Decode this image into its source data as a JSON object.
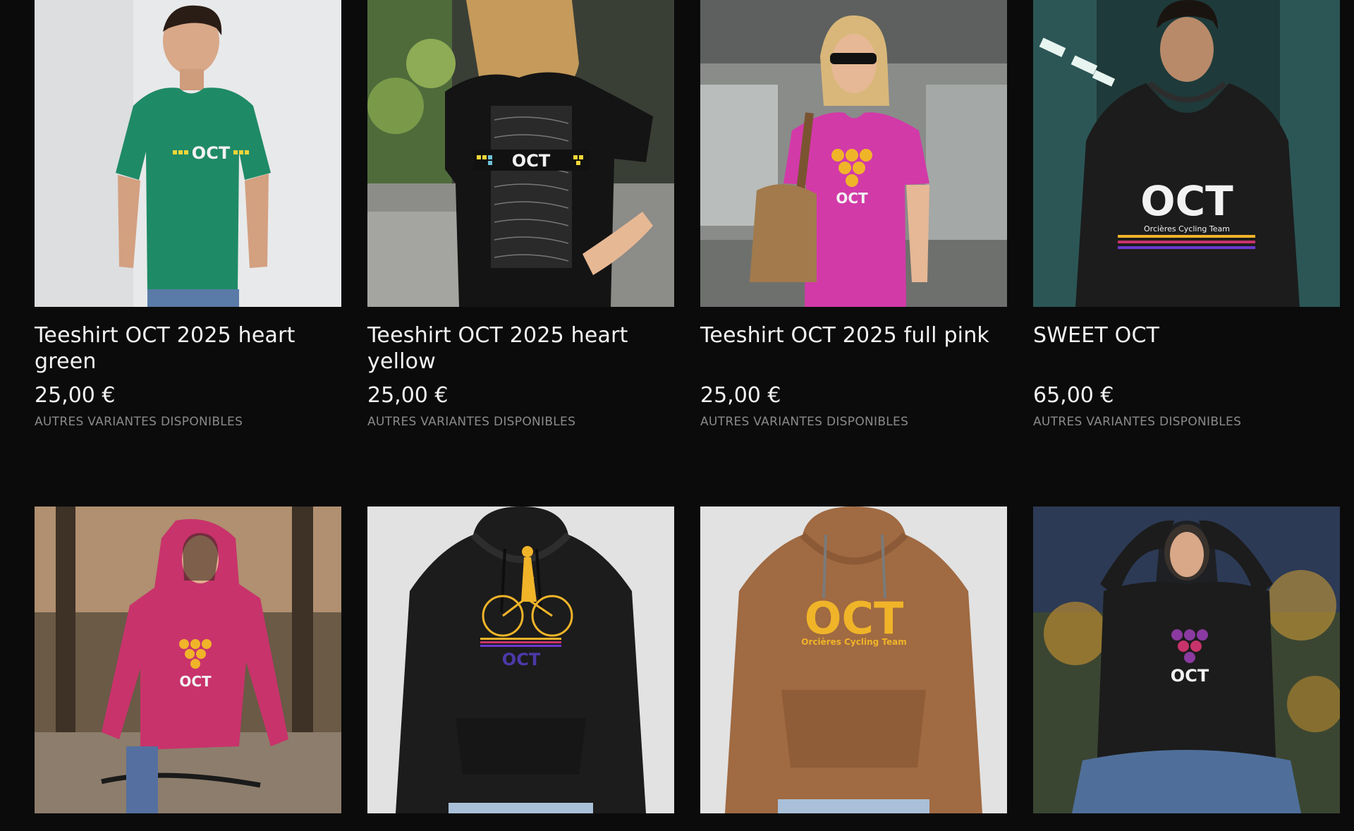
{
  "products": [
    {
      "title": "Teeshirt OCT 2025 heart green",
      "price": "25,00 €",
      "variants": "AUTRES VARIANTES DISPONIBLES",
      "image": "man-green-tshirt"
    },
    {
      "title": "Teeshirt OCT 2025 heart yellow",
      "price": "25,00 €",
      "variants": "AUTRES VARIANTES DISPONIBLES",
      "image": "woman-black-tshirt"
    },
    {
      "title": "Teeshirt OCT 2025 full pink",
      "price": "25,00 €",
      "variants": "AUTRES VARIANTES DISPONIBLES",
      "image": "woman-pink-tshirt"
    },
    {
      "title": "SWEET OCT",
      "price": "65,00 €",
      "variants": "AUTRES VARIANTES DISPONIBLES",
      "image": "man-black-hoodie"
    },
    {
      "image": "woman-pink-hoodie-bike"
    },
    {
      "image": "black-hoodie-cyclist"
    },
    {
      "image": "brown-hoodie-oct"
    },
    {
      "image": "woman-black-hoodie"
    }
  ],
  "logos": {
    "oct": "OCT",
    "team": "Orcières Cycling Team"
  },
  "colors": {
    "background": "#0b0b0b",
    "text": "#f4f4f4",
    "muted": "#8a8a8a",
    "green_shirt": "#1f8a66",
    "pink_shirt": "#d23aa8",
    "black_garment": "#1c1c1c",
    "pink_hoodie": "#c8336b",
    "brown_hoodie": "#a06a42",
    "logo_yellow": "#f0b429"
  }
}
